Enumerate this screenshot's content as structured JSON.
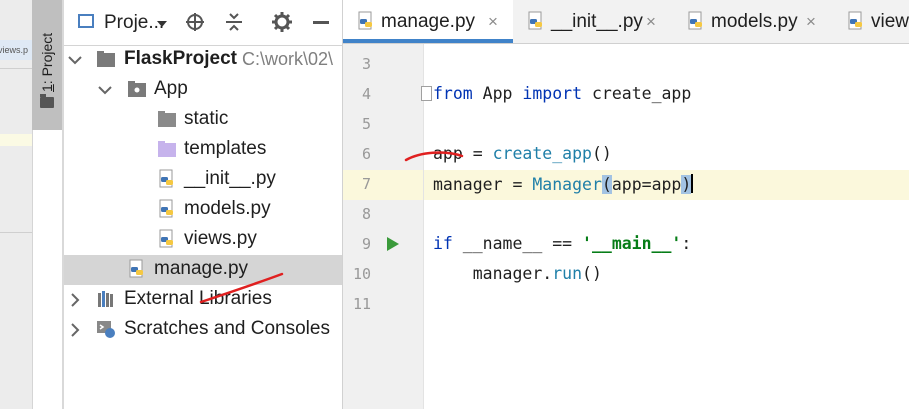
{
  "toolwindow": {
    "stripe_label": "1: Project",
    "stripe_label_number": "1",
    "stripe_label_rest": ": Project"
  },
  "background_fragment": "views.p",
  "project_panel": {
    "title": "Proje...",
    "tree": [
      {
        "label": "FlaskProject",
        "extra": "C:\\work\\02\\",
        "icon": "folder-icon",
        "expanded": true
      },
      {
        "label": "App",
        "icon": "package-icon",
        "expanded": true
      },
      {
        "label": "static",
        "icon": "folder-icon"
      },
      {
        "label": "templates",
        "icon": "templates-folder-icon"
      },
      {
        "label": "__init__.py",
        "icon": "python-file-icon"
      },
      {
        "label": "models.py",
        "icon": "python-file-icon"
      },
      {
        "label": "views.py",
        "icon": "python-file-icon"
      },
      {
        "label": "manage.py",
        "icon": "python-file-icon",
        "selected": true
      },
      {
        "label": "External Libraries",
        "icon": "libraries-icon",
        "expanded": false
      },
      {
        "label": "Scratches and Consoles",
        "icon": "scratches-icon",
        "expanded": false
      }
    ]
  },
  "editor": {
    "tabs": [
      {
        "label": "manage.py",
        "active": true,
        "close": "×"
      },
      {
        "label": "__init__.py",
        "active": false,
        "close": "×"
      },
      {
        "label": "models.py",
        "active": false,
        "close": "×"
      },
      {
        "label": "view",
        "active": false
      }
    ],
    "lines": [
      {
        "n": "3",
        "code": ""
      },
      {
        "n": "4",
        "code": "from App import create_app"
      },
      {
        "n": "5",
        "code": ""
      },
      {
        "n": "6",
        "code": "app = create_app()"
      },
      {
        "n": "7",
        "code": "manager = Manager(app=app)",
        "current": true
      },
      {
        "n": "8",
        "code": ""
      },
      {
        "n": "9",
        "code": "if __name__ == '__main__':",
        "runnable": true
      },
      {
        "n": "10",
        "code": "    manager.run()"
      },
      {
        "n": "11",
        "code": ""
      }
    ]
  },
  "colors": {
    "keyword": "#0033b3",
    "string": "#067d17",
    "call": "#1f7fa8",
    "current_line": "#fbf8dc",
    "selection": "#d5d5d5",
    "annotation_red": "#e02020",
    "tab_underline": "#4083c9"
  }
}
